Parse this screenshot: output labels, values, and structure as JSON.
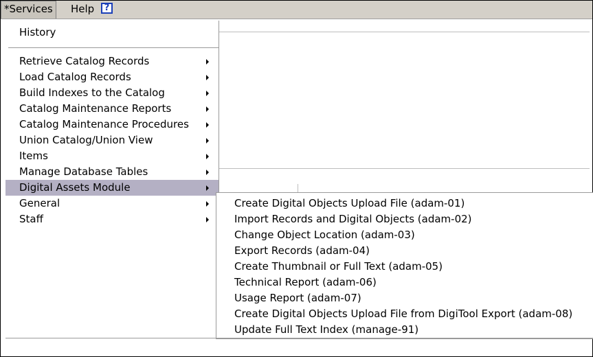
{
  "menubar": {
    "services_label": "*Services",
    "help_label": "Help",
    "help_icon_glyph": "?"
  },
  "services_menu": {
    "history_label": "History",
    "items": [
      {
        "label": "Retrieve Catalog Records",
        "has_submenu": true
      },
      {
        "label": "Load Catalog Records",
        "has_submenu": true
      },
      {
        "label": "Build Indexes to the Catalog",
        "has_submenu": true
      },
      {
        "label": "Catalog Maintenance Reports",
        "has_submenu": true
      },
      {
        "label": "Catalog Maintenance Procedures",
        "has_submenu": true
      },
      {
        "label": "Union Catalog/Union View",
        "has_submenu": true
      },
      {
        "label": "Items",
        "has_submenu": true
      },
      {
        "label": "Manage Database Tables",
        "has_submenu": true
      },
      {
        "label": "Digital Assets Module",
        "has_submenu": true,
        "selected": true
      },
      {
        "label": "General",
        "has_submenu": true
      },
      {
        "label": "Staff",
        "has_submenu": true
      }
    ]
  },
  "digital_assets_submenu": {
    "items": [
      {
        "label": "Create Digital Objects Upload File (adam-01)"
      },
      {
        "label": "Import Records and Digital Objects (adam-02)"
      },
      {
        "label": "Change Object Location (adam-03)"
      },
      {
        "label": "Export Records (adam-04)"
      },
      {
        "label": "Create Thumbnail or Full Text (adam-05)"
      },
      {
        "label": "Technical Report (adam-06)"
      },
      {
        "label": "Usage Report (adam-07)"
      },
      {
        "label": "Create Digital Objects Upload File from DigiTool Export (adam-08)"
      },
      {
        "label": "Update Full Text Index (manage-91)"
      }
    ]
  },
  "colors": {
    "selected_highlight": "#b4b0c4",
    "menubar_bg": "#d4d0c8",
    "help_icon": "#1a3fb8"
  }
}
